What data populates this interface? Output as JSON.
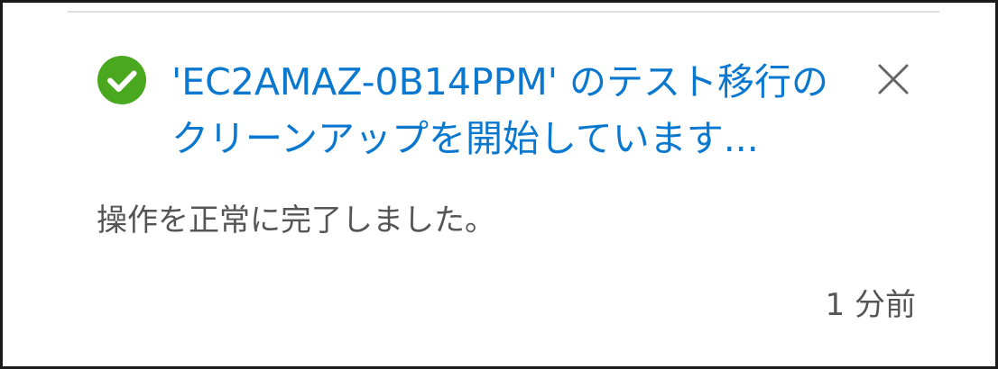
{
  "notification": {
    "status": "success",
    "status_icon": "check-circle-icon",
    "title": "'EC2AMAZ-0B14PPM' のテスト移行のクリーンアップを開始しています...",
    "message": "操作を正常に完了しました。",
    "timestamp": "1 分前",
    "close_icon": "close-icon"
  },
  "colors": {
    "success": "#4aa81f",
    "title": "#0b78d0",
    "body_text": "#555555",
    "icon_gray": "#666666"
  }
}
